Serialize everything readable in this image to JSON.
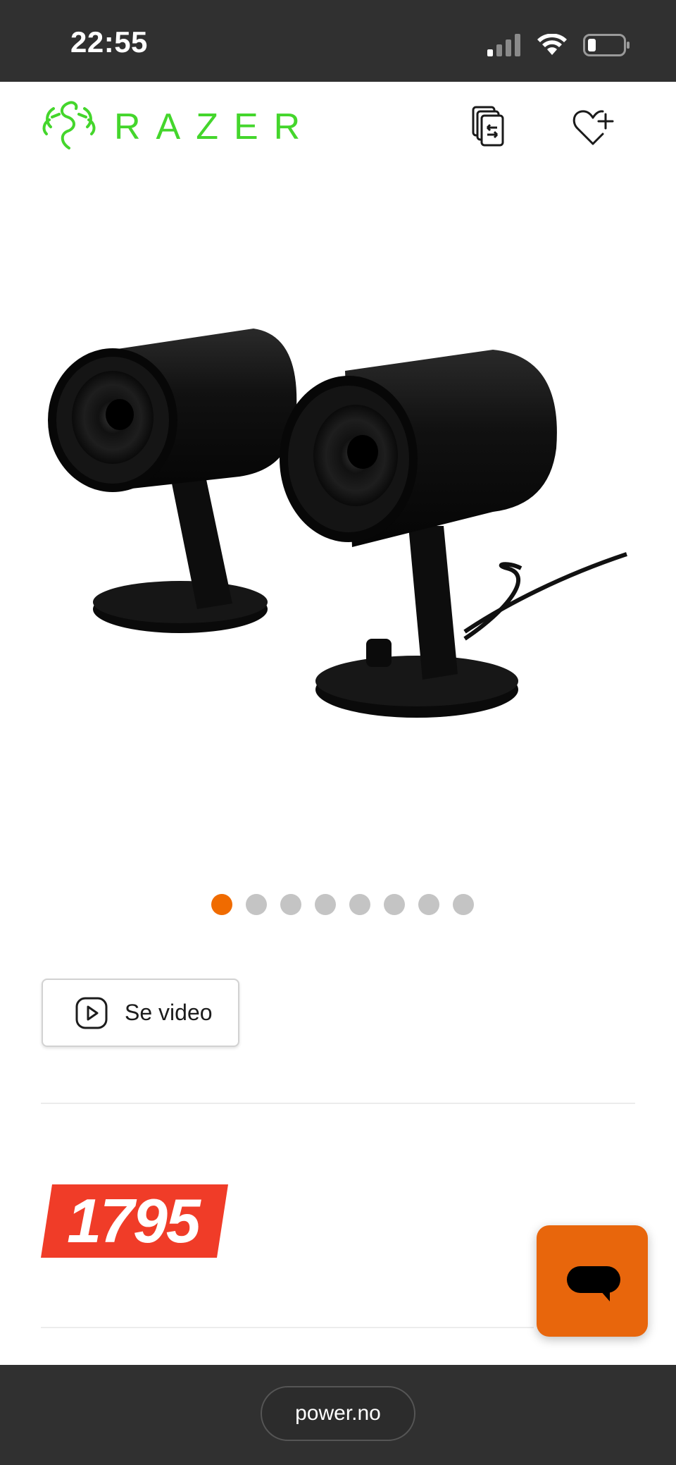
{
  "status_bar": {
    "time": "22:55",
    "icons": [
      "cellular-signal-icon",
      "wifi-icon",
      "battery-icon"
    ]
  },
  "header": {
    "brand": "RAZER",
    "brand_color": "#44d62c",
    "icons": [
      "compare-icon",
      "wishlist-add-icon"
    ]
  },
  "gallery": {
    "image": "product-image",
    "dot_count": 8,
    "active_dot": 0,
    "active_color": "#f06b00"
  },
  "video": {
    "label": "Se video"
  },
  "price": {
    "value": "1795",
    "tag_color": "#f03c28"
  },
  "chat": {
    "icon": "chat-bubble-icon",
    "color": "#e8660c"
  },
  "browser": {
    "url": "power.no"
  }
}
